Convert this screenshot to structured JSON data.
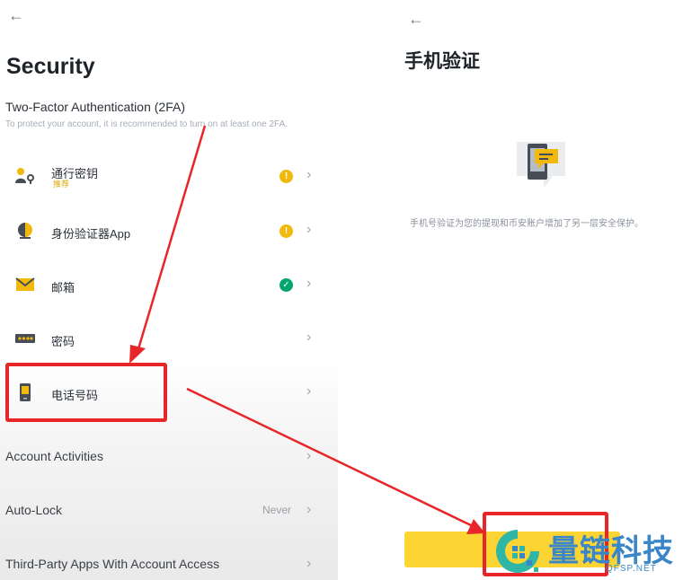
{
  "left": {
    "back_icon": "←",
    "title": "Security",
    "twofa": {
      "title": "Two-Factor Authentication (2FA)",
      "subtitle": "To protect your account, it is recommended to turn on at least one 2FA."
    },
    "items": [
      {
        "label": "通行密钥",
        "tag": "推荐",
        "icon": "passkey-icon",
        "status": "warning"
      },
      {
        "label": "身份验证器App",
        "icon": "authenticator-icon",
        "status": "warning"
      },
      {
        "label": "邮箱",
        "icon": "email-icon",
        "status": "verified"
      },
      {
        "label": "密码",
        "icon": "password-icon",
        "status": ""
      },
      {
        "label": "电话号码",
        "icon": "phone-icon",
        "status": ""
      }
    ],
    "account_rows": [
      {
        "label": "Account Activities",
        "value": ""
      },
      {
        "label": "Auto-Lock",
        "value": "Never"
      },
      {
        "label": "Third-Party Apps With Account Access",
        "value": ""
      }
    ],
    "chevron": "›",
    "warn_glyph": "!",
    "ok_glyph": "✓"
  },
  "right": {
    "back_icon": "←",
    "title": "手机验证",
    "description": "手机号验证为您的提现和币安账户增加了另一层安全保护。",
    "illustration_icon": "phone-message-icon",
    "button_label": ""
  },
  "watermark": {
    "brand": "量链科技",
    "domain": "QFSP.NET"
  },
  "colors": {
    "accent_yellow": "#fcd535",
    "warning": "#f0b90b",
    "verified": "#03a66d",
    "annotation_red": "#e8262a",
    "watermark_blue": "#3a86c8"
  }
}
